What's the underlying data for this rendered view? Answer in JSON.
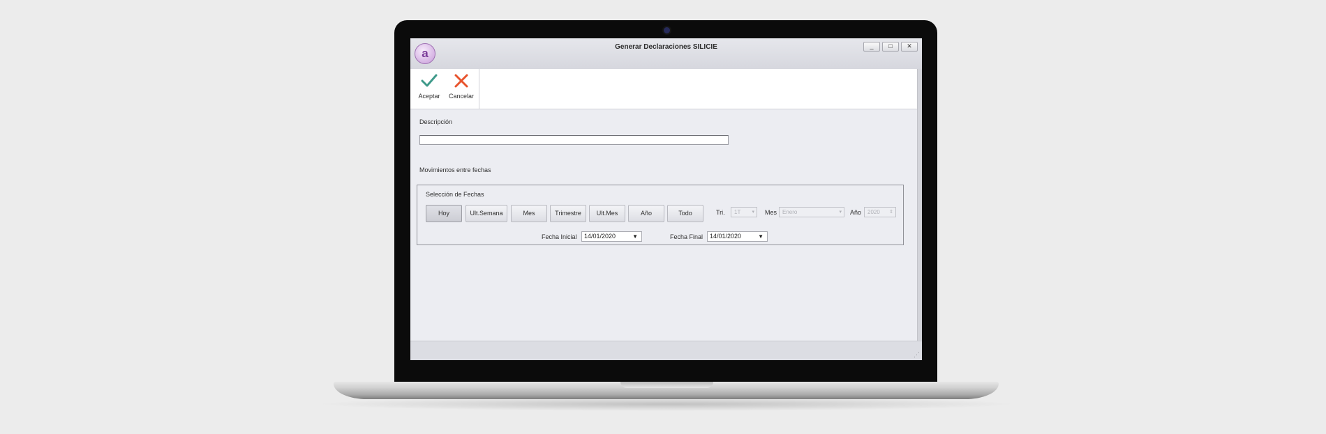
{
  "window": {
    "title": "Generar Declaraciones SILICIE",
    "app_logo_letter": "a",
    "controls": [
      "_",
      "□",
      "✕"
    ]
  },
  "toolbar": {
    "accept": {
      "label": "Aceptar",
      "icon": "check-icon",
      "color": "#3f9a8a"
    },
    "cancel": {
      "label": "Cancelar",
      "icon": "close-icon",
      "color": "#e8532c"
    }
  },
  "form": {
    "descripcion_label": "Descripción",
    "descripcion_value": "",
    "movimientos_label": "Movimientos entre fechas",
    "seleccion_label": "Selección de Fechas",
    "quick_buttons": [
      "Hoy",
      "Ult.Semana",
      "Mes",
      "Trimestre",
      "Ult.Mes",
      "Año",
      "Todo"
    ],
    "active_button": "Hoy",
    "tri_label": "Tri.",
    "tri_value": "1T",
    "mes_label": "Mes",
    "mes_value": "Enero",
    "anio_label": "Año",
    "anio_value": "2020",
    "fecha_inicial_label": "Fecha Inicial",
    "fecha_inicial_value": "14/01/2020",
    "fecha_final_label": "Fecha Final",
    "fecha_final_value": "14/01/2020"
  }
}
